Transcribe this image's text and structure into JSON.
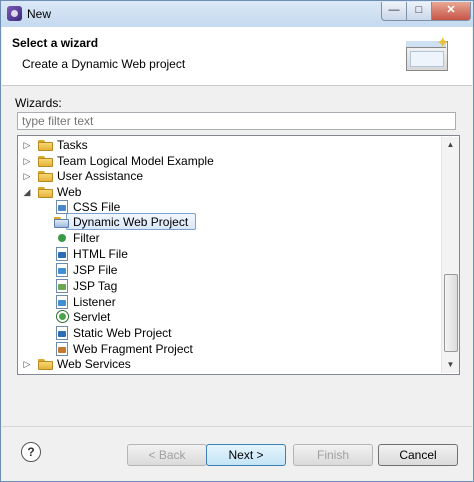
{
  "window": {
    "title": "New"
  },
  "header": {
    "title": "Select a wizard",
    "description": "Create a Dynamic Web project"
  },
  "wizards_label": "Wizards:",
  "filter": {
    "placeholder": "type filter text",
    "value": ""
  },
  "tree": {
    "items": [
      {
        "label": "Tasks",
        "icon": "folder-icon",
        "expanded": false
      },
      {
        "label": "Team Logical Model Example",
        "icon": "folder-icon",
        "expanded": false
      },
      {
        "label": "User Assistance",
        "icon": "folder-icon",
        "expanded": false
      },
      {
        "label": "Web",
        "icon": "folder-icon",
        "expanded": true
      },
      {
        "label": "CSS File",
        "icon": "css-file-icon"
      },
      {
        "label": "Dynamic Web Project",
        "icon": "dynamic-web-project-icon",
        "selected": true
      },
      {
        "label": "Filter",
        "icon": "filter-icon"
      },
      {
        "label": "HTML File",
        "icon": "html-file-icon"
      },
      {
        "label": "JSP File",
        "icon": "jsp-file-icon"
      },
      {
        "label": "JSP Tag",
        "icon": "jsp-tag-icon"
      },
      {
        "label": "Listener",
        "icon": "listener-icon"
      },
      {
        "label": "Servlet",
        "icon": "servlet-icon"
      },
      {
        "label": "Static Web Project",
        "icon": "static-web-project-icon"
      },
      {
        "label": "Web Fragment Project",
        "icon": "web-fragment-project-icon"
      },
      {
        "label": "Web Services",
        "icon": "folder-icon",
        "expanded": false
      }
    ]
  },
  "buttons": {
    "help": "?",
    "back": "< Back",
    "next": "Next >",
    "finish": "Finish",
    "cancel": "Cancel"
  },
  "colors": {
    "selection": "#d9e8fa",
    "folder": "#e4b43b",
    "title_bar": "#c4d9ef"
  }
}
